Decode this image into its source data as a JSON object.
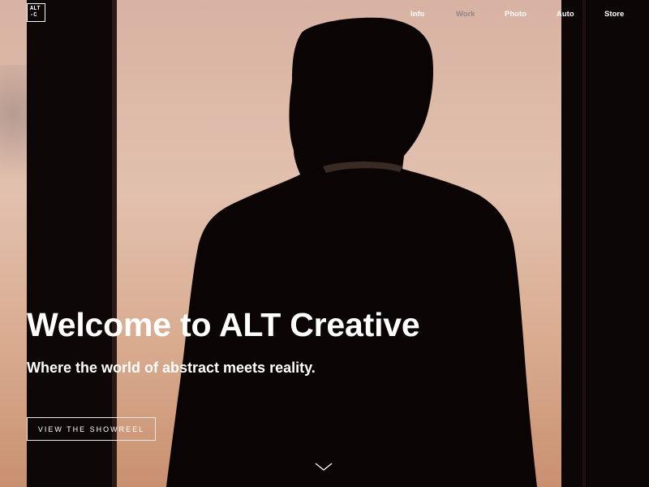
{
  "brand": {
    "logo_line1": "ALT",
    "logo_line2": "-C"
  },
  "nav": {
    "items": [
      {
        "label": "Info",
        "active": false
      },
      {
        "label": "Work",
        "active": true
      },
      {
        "label": "Photo",
        "active": false
      },
      {
        "label": "Auto",
        "active": false
      },
      {
        "label": "Store",
        "active": false
      }
    ]
  },
  "hero": {
    "title": "Welcome to ALT Creative",
    "subtitle": "Where the world of abstract meets reality.",
    "cta_label": "VIEW THE SHOWREEL",
    "scroll_icon": "chevron-down-icon"
  },
  "colors": {
    "text": "#ffffff",
    "nav_active": "#8a8a8a",
    "sky_top": "#d9b4a4",
    "sky_bottom": "#c9946f",
    "silhouette": "#0a0405"
  }
}
